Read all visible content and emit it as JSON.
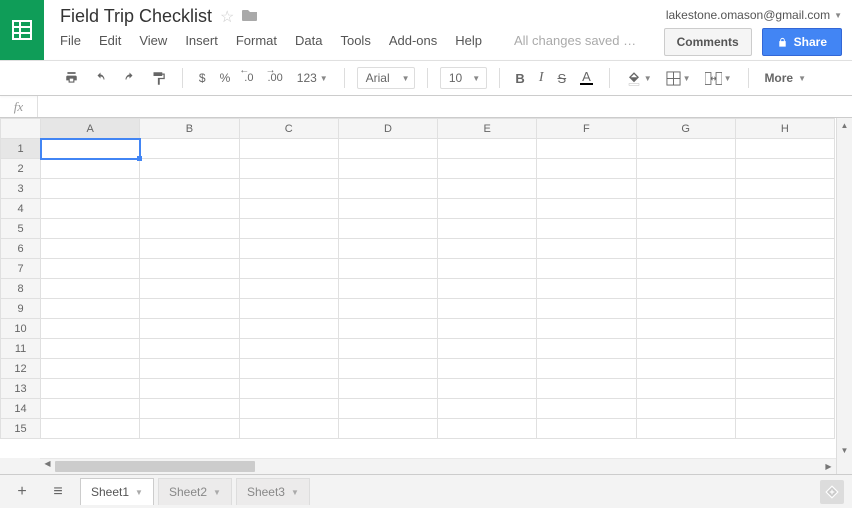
{
  "doc": {
    "title": "Field Trip Checklist"
  },
  "user": {
    "email": "lakestone.omason@gmail.com"
  },
  "header": {
    "comments": "Comments",
    "share": "Share"
  },
  "menu": {
    "file": "File",
    "edit": "Edit",
    "view": "View",
    "insert": "Insert",
    "format": "Format",
    "data": "Data",
    "tools": "Tools",
    "addons": "Add-ons",
    "help": "Help",
    "save_status": "All changes saved …"
  },
  "toolbar": {
    "currency": "$",
    "percent": "%",
    "dec_dec": ".0",
    "inc_dec": ".00",
    "num_format": "123",
    "font": "Arial",
    "size": "10",
    "bold": "B",
    "italic": "I",
    "strike": "S",
    "textcolor": "A",
    "more": "More"
  },
  "formula": {
    "fx": "fx",
    "value": ""
  },
  "columns": [
    "A",
    "B",
    "C",
    "D",
    "E",
    "F",
    "G",
    "H"
  ],
  "rows": [
    "1",
    "2",
    "3",
    "4",
    "5",
    "6",
    "7",
    "8",
    "9",
    "10",
    "11",
    "12",
    "13",
    "14",
    "15"
  ],
  "active_cell": {
    "row": 0,
    "col": 0
  },
  "tabs": [
    {
      "label": "Sheet1",
      "active": true
    },
    {
      "label": "Sheet2",
      "active": false
    },
    {
      "label": "Sheet3",
      "active": false
    }
  ]
}
